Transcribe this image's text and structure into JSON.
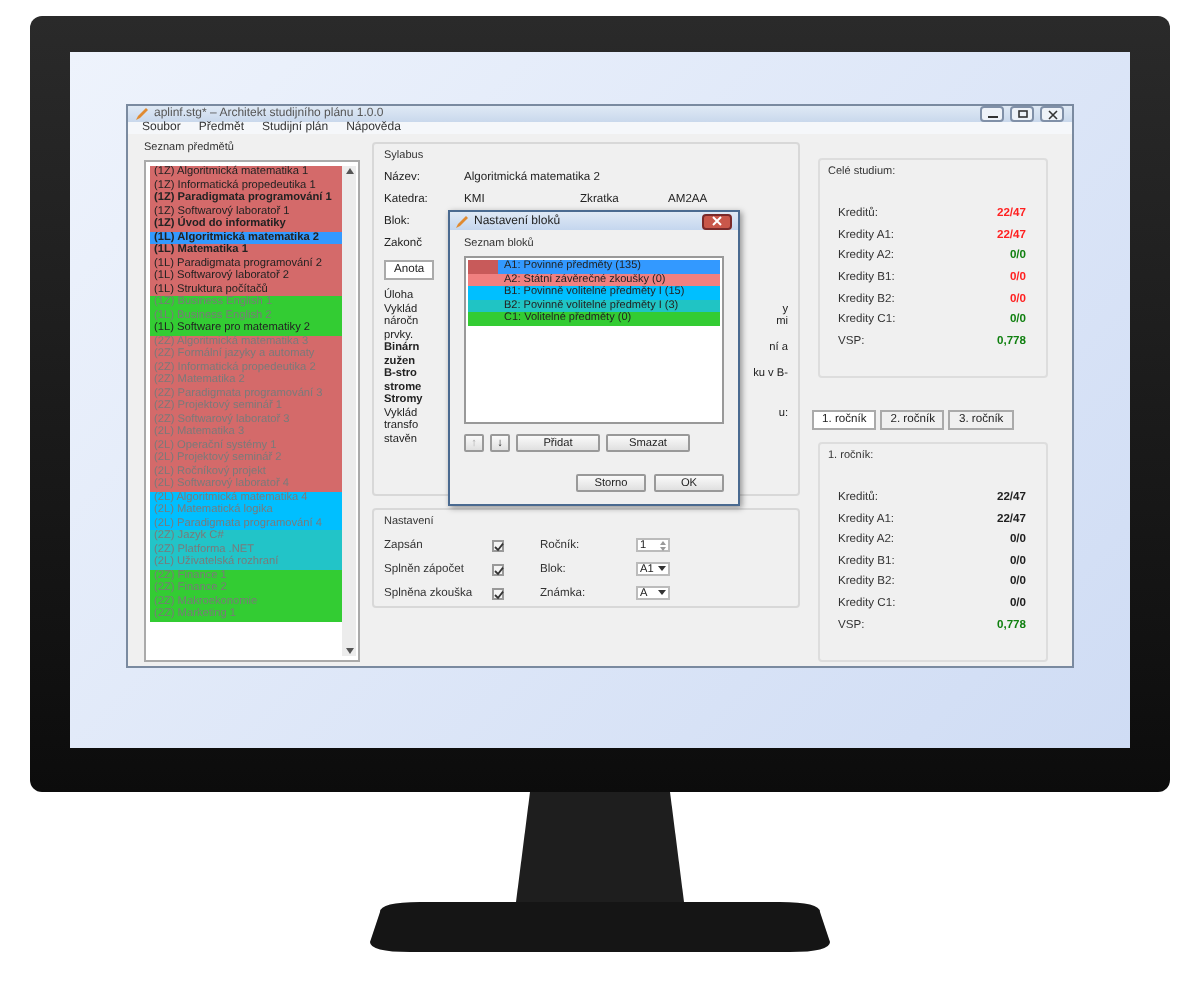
{
  "window": {
    "title": "aplinf.stg* – Architekt studijního plánu 1.0.0"
  },
  "menu": [
    "Soubor",
    "Předmět",
    "Studijní plán",
    "Nápověda"
  ],
  "subjects": {
    "title": "Seznam předmětů",
    "items": [
      {
        "text": "(1Z) Algoritmická matematika 1",
        "bold": false,
        "dimmed": false,
        "selected": false,
        "color": "#d46a6a"
      },
      {
        "text": "(1Z) Informatická propedeutika 1",
        "bold": false,
        "dimmed": false,
        "selected": false,
        "color": "#d46a6a"
      },
      {
        "text": "(1Z) Paradigmata programování 1",
        "bold": true,
        "dimmed": false,
        "selected": false,
        "color": "#d46a6a"
      },
      {
        "text": "(1Z) Softwarový laboratoř 1",
        "bold": false,
        "dimmed": false,
        "selected": false,
        "color": "#d46a6a"
      },
      {
        "text": "(1Z) Úvod do informatiky",
        "bold": true,
        "dimmed": false,
        "selected": false,
        "color": "#d46a6a"
      },
      {
        "text": "(1L) Algoritmická matematika 2",
        "bold": true,
        "dimmed": false,
        "selected": true
      },
      {
        "text": "(1L) Matematika 1",
        "bold": true,
        "dimmed": false,
        "selected": false,
        "color": "#d46a6a"
      },
      {
        "text": "(1L) Paradigmata programování 2",
        "bold": false,
        "dimmed": false,
        "selected": false,
        "color": "#d46a6a"
      },
      {
        "text": "(1L) Softwarový laboratoř 2",
        "bold": false,
        "dimmed": false,
        "selected": false,
        "color": "#d46a6a"
      },
      {
        "text": "(1L) Struktura počítačů",
        "bold": false,
        "dimmed": false,
        "selected": false,
        "color": "#d46a6a"
      },
      {
        "text": "(1Z) Business English 1",
        "bold": false,
        "dimmed": true,
        "selected": false,
        "color": "#33cc33"
      },
      {
        "text": "(1L) Business English 2",
        "bold": false,
        "dimmed": true,
        "selected": false,
        "color": "#33cc33"
      },
      {
        "text": "(1L) Software pro matematiky 2",
        "bold": false,
        "dimmed": false,
        "selected": false,
        "color": "#33cc33"
      },
      {
        "text": "(2Z) Algoritmická matematika 3",
        "bold": false,
        "dimmed": true,
        "selected": false,
        "color": "#d46a6a"
      },
      {
        "text": "(2Z) Formální jazyky a automaty",
        "bold": false,
        "dimmed": true,
        "selected": false,
        "color": "#d46a6a"
      },
      {
        "text": "(2Z) Informatická propedeutika 2",
        "bold": false,
        "dimmed": true,
        "selected": false,
        "color": "#d46a6a"
      },
      {
        "text": "(2Z) Matematika 2",
        "bold": false,
        "dimmed": true,
        "selected": false,
        "color": "#d46a6a"
      },
      {
        "text": "(2Z) Paradigmata programování 3",
        "bold": false,
        "dimmed": true,
        "selected": false,
        "color": "#d46a6a"
      },
      {
        "text": "(2Z) Projektový seminář 1",
        "bold": false,
        "dimmed": true,
        "selected": false,
        "color": "#d46a6a"
      },
      {
        "text": "(2Z) Softwarový laboratoř 3",
        "bold": false,
        "dimmed": true,
        "selected": false,
        "color": "#d46a6a"
      },
      {
        "text": "(2L) Matematika 3",
        "bold": false,
        "dimmed": true,
        "selected": false,
        "color": "#d46a6a"
      },
      {
        "text": "(2L) Operační systémy 1",
        "bold": false,
        "dimmed": true,
        "selected": false,
        "color": "#d46a6a"
      },
      {
        "text": "(2L) Projektový seminář 2",
        "bold": false,
        "dimmed": true,
        "selected": false,
        "color": "#d46a6a"
      },
      {
        "text": "(2L) Ročníkový projekt",
        "bold": false,
        "dimmed": true,
        "selected": false,
        "color": "#d46a6a"
      },
      {
        "text": "(2L) Softwarový laboratoř 4",
        "bold": false,
        "dimmed": true,
        "selected": false,
        "color": "#d46a6a"
      },
      {
        "text": "(2L) Algoritmická matematika 4",
        "bold": false,
        "dimmed": true,
        "selected": false,
        "color": "#00bfff"
      },
      {
        "text": "(2L) Matematická logika",
        "bold": false,
        "dimmed": true,
        "selected": false,
        "color": "#00bfff"
      },
      {
        "text": "(2L) Paradigmata programování 4",
        "bold": false,
        "dimmed": true,
        "selected": false,
        "color": "#00bfff"
      },
      {
        "text": "(2Z) Jazyk C#",
        "bold": false,
        "dimmed": true,
        "selected": false,
        "color": "#22c4c8"
      },
      {
        "text": "(2Z) Platforma .NET",
        "bold": false,
        "dimmed": true,
        "selected": false,
        "color": "#22c4c8"
      },
      {
        "text": "(2L) Uživatelská rozhraní",
        "bold": false,
        "dimmed": true,
        "selected": false,
        "color": "#22c4c8"
      },
      {
        "text": "(2Z) Finance 1",
        "bold": false,
        "dimmed": true,
        "selected": false,
        "color": "#33cc33"
      },
      {
        "text": "(2Z) Finance 2",
        "bold": false,
        "dimmed": true,
        "selected": false,
        "color": "#33cc33"
      },
      {
        "text": "(2Z) Makroekonomie",
        "bold": false,
        "dimmed": true,
        "selected": false,
        "color": "#33cc33"
      },
      {
        "text": "(2Z) Marketing 1",
        "bold": false,
        "dimmed": true,
        "selected": false,
        "color": "#33cc33"
      }
    ]
  },
  "syllabus": {
    "title": "Sylabus",
    "fields": [
      {
        "label": "Název:",
        "value": "Algoritmická matematika 2"
      },
      {
        "label": "Katedra:",
        "value": "KMI",
        "label_2": "Zkratka",
        "value_2": "AM2AA"
      },
      {
        "label": "Blok:"
      },
      {
        "label": "Zakonč"
      }
    ],
    "tab": "Anota",
    "fragments": [
      {
        "left": "Úloha",
        "bold": false
      },
      {
        "left": "Vyklád",
        "right": "y",
        "bold": false
      },
      {
        "left": "náročn",
        "right": "mi",
        "bold": false
      },
      {
        "left": "prvky.",
        "bold": false
      },
      {
        "left": "Binárn",
        "right": "ní a",
        "bold": true
      },
      {
        "left": "zužen",
        "bold": true
      },
      {
        "left": "B-stro",
        "right": "ku v B-",
        "bold": true
      },
      {
        "left": "strome",
        "bold": true
      },
      {
        "left": "Stromy",
        "bold": true
      },
      {
        "left": "Vyklád",
        "right": "u:",
        "bold": false
      },
      {
        "left": "transfo",
        "bold": false
      },
      {
        "left": "stavěn",
        "bold": false
      }
    ]
  },
  "dialog": {
    "title": "Nastavení bloků",
    "list_title": "Seznam bloků",
    "blocks": [
      {
        "text": "A1: Povinné předměty (135)",
        "color": "#c85a5a",
        "selected": true
      },
      {
        "text": "A2: Státní závěrečné zkoušky (0)",
        "color": "#f08080",
        "selected": false
      },
      {
        "text": "B1: Povinně volitelné předměty I (15)",
        "color": "#00bfff",
        "selected": false
      },
      {
        "text": "B2: Povinně volitelné předměty I (3)",
        "color": "#20c4c4",
        "selected": false
      },
      {
        "text": "C1: Volitelné předměty (0)",
        "color": "#33cc33",
        "selected": false
      }
    ],
    "buttons": [
      {
        "label": "↑",
        "disabled": true
      },
      {
        "label": "↓",
        "disabled": false
      },
      {
        "label": "Přidat",
        "disabled": false
      },
      {
        "label": "Smazat",
        "disabled": false
      }
    ],
    "footer": [
      "Storno",
      "OK"
    ]
  },
  "settings": {
    "title": "Nastavení",
    "checks": [
      {
        "label": "Zapsán",
        "checked": true
      },
      {
        "label": "Splněn zápočet",
        "checked": true
      },
      {
        "label": "Splněna zkouška",
        "checked": true
      }
    ],
    "fields": [
      {
        "kind": "spin",
        "label": "Ročník:",
        "value": "1"
      },
      {
        "kind": "select",
        "label": "Blok:",
        "value": "A1"
      },
      {
        "kind": "select",
        "label": "Známka:",
        "value": "A"
      }
    ]
  },
  "total": {
    "title": "Celé studium:",
    "rows": [
      {
        "label": "Kreditů:",
        "value": "22/47",
        "color": "#ff2020"
      },
      {
        "label": "Kredity A1:",
        "value": "22/47",
        "color": "#ff2020"
      },
      {
        "label": "Kredity A2:",
        "value": "0/0",
        "color": "#108010"
      },
      {
        "label": "Kredity B1:",
        "value": "0/0",
        "color": "#ff2020"
      },
      {
        "label": "Kredity B2:",
        "value": "0/0",
        "color": "#ff2020"
      },
      {
        "label": "Kredity C1:",
        "value": "0/0",
        "color": "#108010"
      },
      {
        "label": "VSP:",
        "value": "0,778",
        "color": "#108010"
      }
    ]
  },
  "year_tabs": [
    {
      "label": "1. ročník",
      "selected": true
    },
    {
      "label": "2. ročník",
      "selected": false
    },
    {
      "label": "3. ročník",
      "selected": false
    }
  ],
  "year": {
    "title": "1. ročník:",
    "rows": [
      {
        "label": "Kreditů:",
        "value": "22/47",
        "color": "#202020"
      },
      {
        "label": "Kredity A1:",
        "value": "22/47",
        "color": "#202020"
      },
      {
        "label": "Kredity A2:",
        "value": "0/0",
        "color": "#202020"
      },
      {
        "label": "Kredity B1:",
        "value": "0/0",
        "color": "#202020"
      },
      {
        "label": "Kredity B2:",
        "value": "0/0",
        "color": "#202020"
      },
      {
        "label": "Kredity C1:",
        "value": "0/0",
        "color": "#202020"
      },
      {
        "label": "VSP:",
        "value": "0,778",
        "color": "#108010"
      }
    ]
  }
}
